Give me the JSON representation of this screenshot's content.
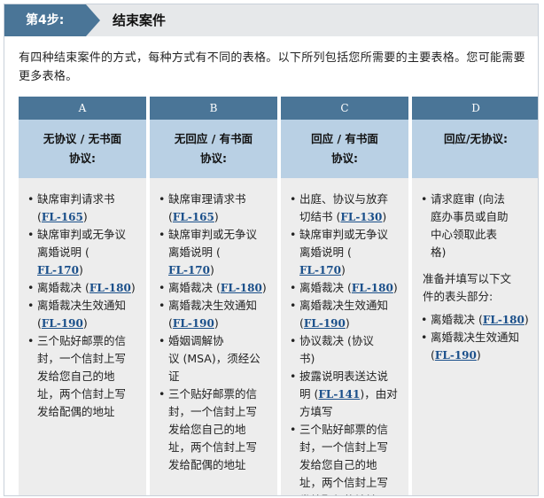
{
  "header": {
    "step_label": "第4步:",
    "title": "结束案件"
  },
  "intro": "有四种结束案件的方式，每种方式有不同的表格。以下所列包括您所需要的主要表格。您可能需要更多表格。",
  "columns": [
    {
      "letter": "A",
      "subtitle_l1": "无协议 / 无书面",
      "subtitle_l2": "协议:",
      "items": [
        {
          "lines": [
            "缺席审判请求书",
            [
              "(",
              "FL-165",
              ")"
            ]
          ]
        },
        {
          "lines": [
            "缺席审判或无争议",
            "离婚说明 (",
            [
              "",
              "FL-170",
              ")"
            ]
          ]
        },
        {
          "lines": [
            [
              "离婚裁决 (",
              "FL-180",
              ")"
            ]
          ]
        },
        {
          "lines": [
            "离婚裁决生效通知",
            [
              "(",
              "FL-190",
              ")"
            ]
          ]
        },
        {
          "lines": [
            "三个贴好邮票的信",
            "封，一个信封上写",
            "发给您自己的地",
            "址，两个信封上写",
            "发给配偶的地址"
          ]
        }
      ]
    },
    {
      "letter": "B",
      "subtitle_l1": "无回应 / 有书面",
      "subtitle_l2": "协议:",
      "items": [
        {
          "lines": [
            "缺席审理请求书",
            [
              "(",
              "FL-165",
              ")"
            ]
          ]
        },
        {
          "lines": [
            "缺席审判或无争议",
            "离婚说明 (",
            [
              "",
              "FL-170",
              ")"
            ]
          ]
        },
        {
          "lines": [
            [
              "离婚裁决 (",
              "FL-180",
              ")"
            ]
          ]
        },
        {
          "lines": [
            "离婚裁决生效通知",
            [
              "(",
              "FL-190",
              ")"
            ]
          ]
        },
        {
          "lines": [
            "婚姻调解协",
            "议 (MSA)，须经公",
            "证"
          ]
        },
        {
          "lines": [
            "三个贴好邮票的信",
            "封，一个信封上写",
            "发给您自己的地",
            "址，两个信封上写",
            "发给配偶的地址"
          ]
        }
      ]
    },
    {
      "letter": "C",
      "subtitle_l1": "回应 / 有书面",
      "subtitle_l2": "协议:",
      "items": [
        {
          "lines": [
            "出庭、协议与放弃",
            [
              "切结书 (",
              "FL-130",
              ")"
            ]
          ]
        },
        {
          "lines": [
            "缺席审判或无争议",
            "离婚说明 (",
            [
              "",
              "FL-170",
              ")"
            ]
          ]
        },
        {
          "lines": [
            [
              "离婚裁决 (",
              "FL-180",
              ")"
            ]
          ]
        },
        {
          "lines": [
            "离婚裁决生效通知",
            [
              "(",
              "FL-190",
              ")"
            ]
          ]
        },
        {
          "lines": [
            "协议裁决 (协议",
            "书)"
          ]
        },
        {
          "lines": [
            "披露说明表送达说",
            [
              "明 (",
              "FL-141",
              ")，由对"
            ],
            "方填写"
          ]
        },
        {
          "lines": [
            "三个贴好邮票的信",
            "封，一个信封上写",
            "发给您自己的地",
            "址，两个信封上写",
            "发给配偶的地址"
          ]
        }
      ]
    },
    {
      "letter": "D",
      "subtitle_l1": "回应/无协议:",
      "subtitle_l2": "",
      "items": [
        {
          "lines": [
            "请求庭审 (向法",
            "庭办事员或自助",
            "中心领取此表",
            "格)"
          ]
        }
      ],
      "note": [
        "准备并填写以下文",
        "件的表头部分:"
      ],
      "items2": [
        {
          "lines": [
            [
              "离婚裁决 (",
              "FL-180",
              ")"
            ]
          ]
        },
        {
          "lines": [
            "离婚裁决生效通知",
            [
              "(",
              "FL-190",
              ")"
            ]
          ]
        }
      ]
    }
  ]
}
